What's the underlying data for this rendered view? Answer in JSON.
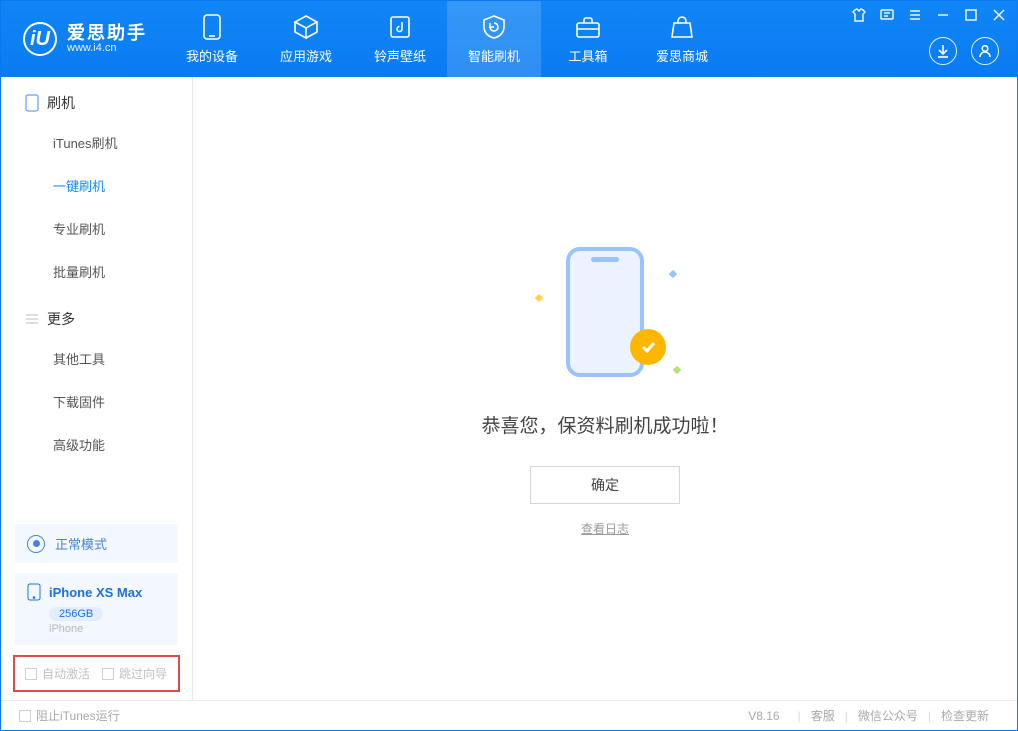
{
  "app": {
    "name_cn": "爱思助手",
    "url": "www.i4.cn"
  },
  "tabs": {
    "device": "我的设备",
    "apps": "应用游戏",
    "ring": "铃声壁纸",
    "flash": "智能刷机",
    "tools": "工具箱",
    "store": "爱思商城"
  },
  "sidebar": {
    "group_flash": "刷机",
    "items_flash": {
      "itunes": "iTunes刷机",
      "onekey": "一键刷机",
      "pro": "专业刷机",
      "batch": "批量刷机"
    },
    "group_more": "更多",
    "items_more": {
      "other": "其他工具",
      "firmware": "下载固件",
      "advanced": "高级功能"
    }
  },
  "mode": {
    "label": "正常模式"
  },
  "device": {
    "name": "iPhone XS Max",
    "capacity": "256GB",
    "type": "iPhone"
  },
  "options": {
    "auto_activate": "自动激活",
    "skip_guide": "跳过向导"
  },
  "main": {
    "success": "恭喜您，保资料刷机成功啦！",
    "ok": "确定",
    "view_log": "查看日志"
  },
  "footer": {
    "block_itunes": "阻止iTunes运行",
    "version": "V8.16",
    "support": "客服",
    "wechat": "微信公众号",
    "update": "检查更新"
  }
}
